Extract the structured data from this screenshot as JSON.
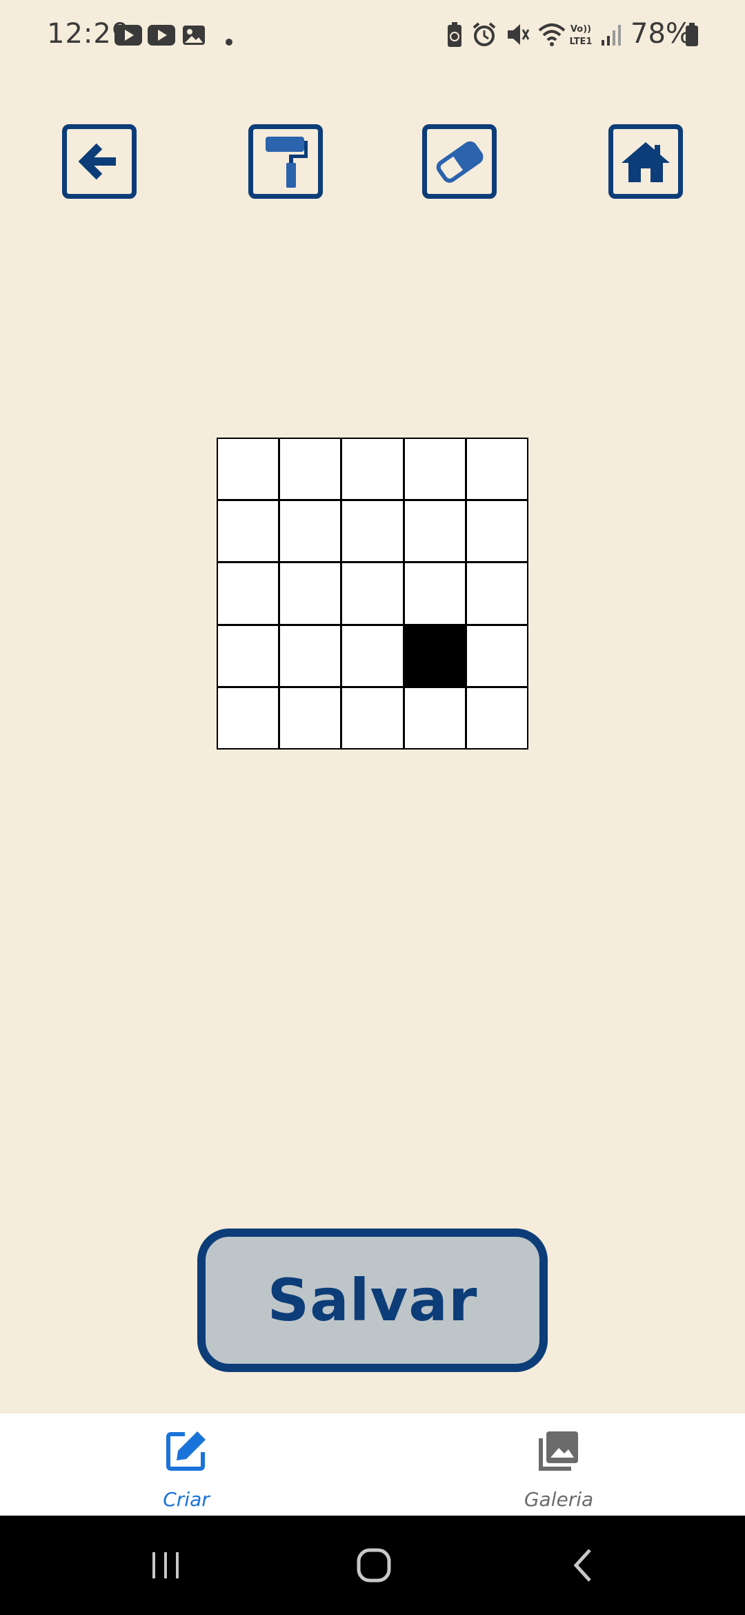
{
  "status_bar": {
    "time": "12:29",
    "battery": "78%"
  },
  "toolbar": {
    "back_icon": "arrow-left-icon",
    "paint_icon": "paint-roller-icon",
    "eraser_icon": "eraser-icon",
    "home_icon": "home-icon"
  },
  "canvas": {
    "rows": 5,
    "cols": 5,
    "filled_cells": [
      [
        3,
        3
      ]
    ]
  },
  "save_button": {
    "label": "Salvar"
  },
  "bottom_nav": {
    "items": [
      {
        "label": "Criar",
        "icon": "edit-icon",
        "active": true
      },
      {
        "label": "Galeria",
        "icon": "gallery-icon",
        "active": false
      }
    ]
  },
  "colors": {
    "background": "#f5ecdb",
    "primary": "#0c3d78",
    "active_nav": "#1a73d9",
    "inactive_nav": "#6b6b6b",
    "save_fill": "#bec5c9"
  }
}
